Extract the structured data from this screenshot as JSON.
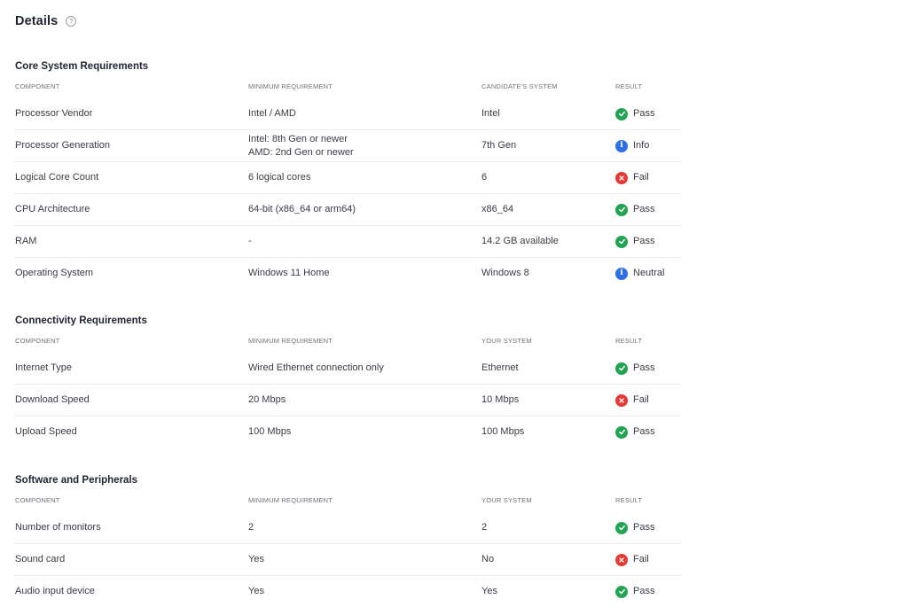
{
  "header": {
    "title": "Details",
    "help_icon": "help-circle-icon"
  },
  "colors": {
    "pass": "#23a455",
    "fail": "#e53935",
    "info": "#2f6fe4"
  },
  "sections": [
    {
      "title": "Core System Requirements",
      "headers": [
        "COMPONENT",
        "MINIMUM REQUIREMENT",
        "CANDIDATE'S SYSTEM",
        "RESULT"
      ],
      "rows": [
        {
          "component": "Processor Vendor",
          "requirement": "Intel / AMD",
          "requirement2": "",
          "system": "Intel",
          "result": "Pass",
          "status": "pass"
        },
        {
          "component": "Processor Generation",
          "requirement": "Intel: 8th Gen or newer",
          "requirement2": "AMD: 2nd Gen or newer",
          "system": "7th Gen",
          "result": "Info",
          "status": "info"
        },
        {
          "component": "Logical Core Count",
          "requirement": "6 logical cores",
          "requirement2": "",
          "system": "6",
          "result": "Fail",
          "status": "fail"
        },
        {
          "component": "CPU Architecture",
          "requirement": "64-bit (x86_64 or arm64)",
          "requirement2": "",
          "system": "x86_64",
          "result": "Pass",
          "status": "pass"
        },
        {
          "component": "RAM",
          "requirement": "-",
          "requirement2": "",
          "system": "14.2 GB available",
          "result": "Pass",
          "status": "pass"
        },
        {
          "component": "Operating System",
          "requirement": "Windows 11 Home",
          "requirement2": "",
          "system": "Windows 8",
          "result": "Neutral",
          "status": "info"
        }
      ]
    },
    {
      "title": "Connectivity Requirements",
      "headers": [
        "COMPONENT",
        "MINIMUM REQUIREMENT",
        "YOUR SYSTEM",
        "RESULT"
      ],
      "rows": [
        {
          "component": "Internet Type",
          "requirement": "Wired Ethernet connection only",
          "requirement2": "",
          "system": "Ethernet",
          "result": "Pass",
          "status": "pass"
        },
        {
          "component": "Download Speed",
          "requirement": "20 Mbps",
          "requirement2": "",
          "system": "10 Mbps",
          "result": "Fail",
          "status": "fail"
        },
        {
          "component": "Upload Speed",
          "requirement": "100 Mbps",
          "requirement2": "",
          "system": "100 Mbps",
          "result": "Pass",
          "status": "pass"
        }
      ]
    },
    {
      "title": "Software and Peripherals",
      "headers": [
        "COMPONENT",
        "MINIMUM REQUIREMENT",
        "YOUR SYSTEM",
        "RESULT"
      ],
      "rows": [
        {
          "component": "Number of monitors",
          "requirement": "2",
          "requirement2": "",
          "system": "2",
          "result": "Pass",
          "status": "pass"
        },
        {
          "component": "Sound card",
          "requirement": "Yes",
          "requirement2": "",
          "system": "No",
          "result": "Fail",
          "status": "fail"
        },
        {
          "component": "Audio input device",
          "requirement": "Yes",
          "requirement2": "",
          "system": "Yes",
          "result": "Pass",
          "status": "pass"
        }
      ]
    }
  ]
}
